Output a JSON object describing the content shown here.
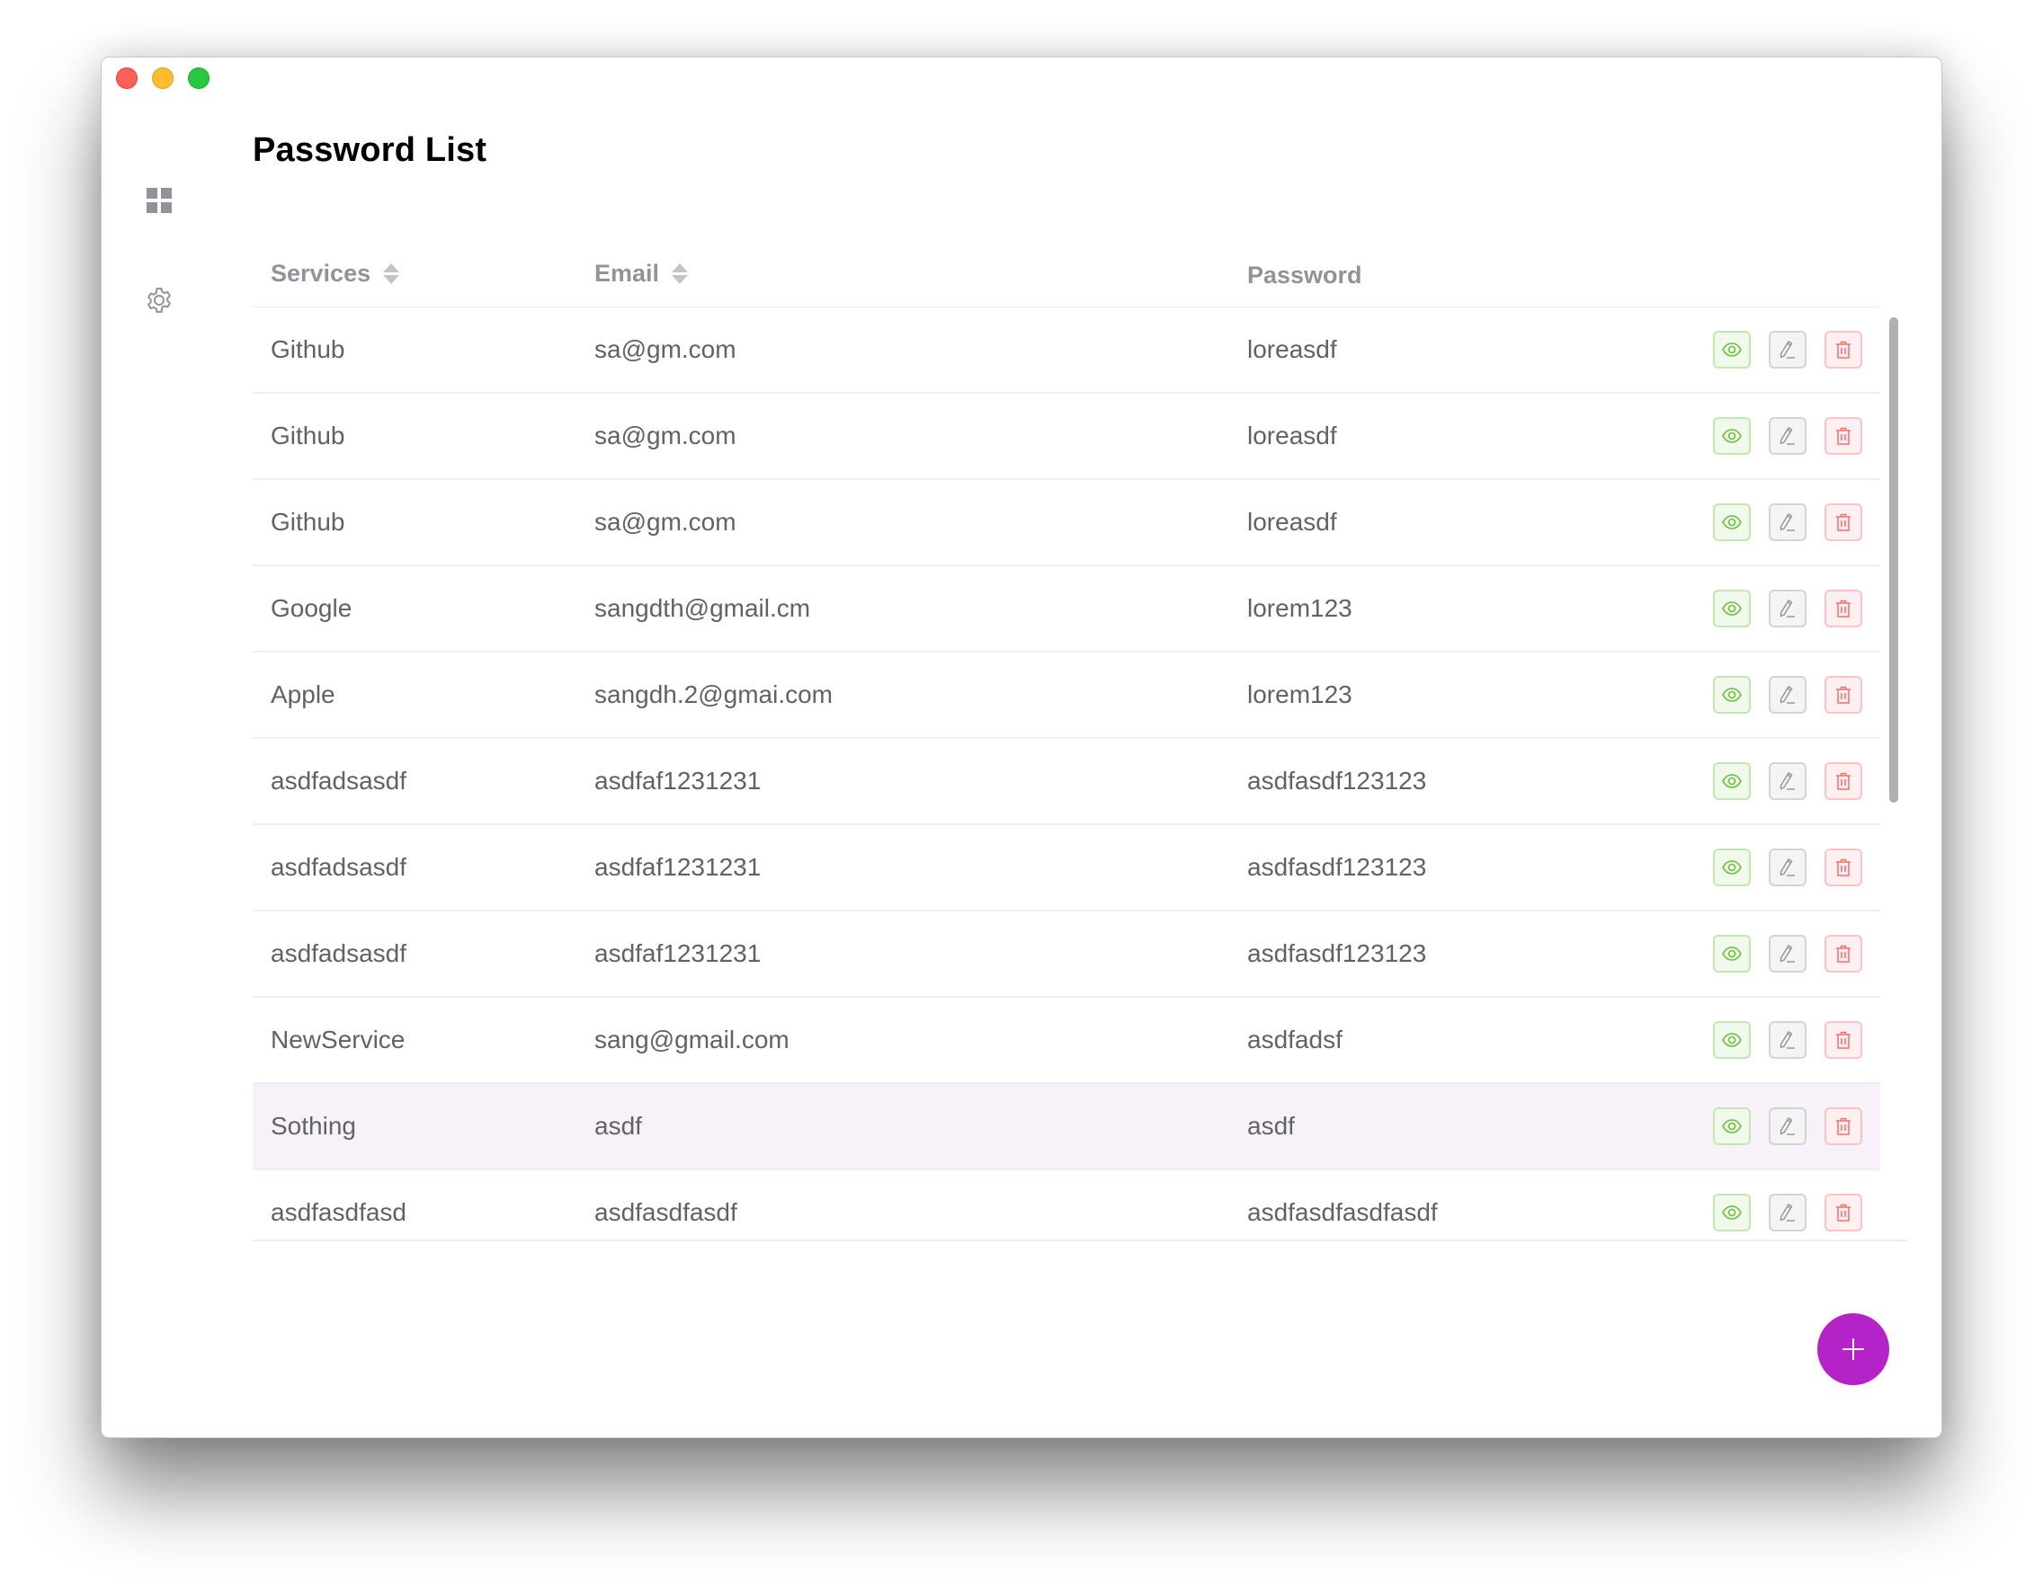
{
  "window": {
    "controls": {
      "close": "close-window",
      "minimize": "minimize-window",
      "maximize": "maximize-window"
    }
  },
  "sidebar": {
    "items": [
      {
        "icon": "grid-icon",
        "name": "dashboard"
      },
      {
        "icon": "gear-icon",
        "name": "settings"
      }
    ]
  },
  "page": {
    "title": "Password List"
  },
  "table": {
    "columns": [
      {
        "label": "Services",
        "sortable": true
      },
      {
        "label": "Email",
        "sortable": true
      },
      {
        "label": "Password",
        "sortable": false
      }
    ],
    "actions": {
      "view_icon": "eye-icon",
      "edit_icon": "edit-icon",
      "delete_icon": "trash-icon"
    },
    "rows": [
      {
        "service": "Github",
        "email": "sa@gm.com",
        "password": "loreasdf",
        "highlighted": false
      },
      {
        "service": "Github",
        "email": "sa@gm.com",
        "password": "loreasdf",
        "highlighted": false
      },
      {
        "service": "Github",
        "email": "sa@gm.com",
        "password": "loreasdf",
        "highlighted": false
      },
      {
        "service": "Google",
        "email": "sangdth@gmail.cm",
        "password": "lorem123",
        "highlighted": false
      },
      {
        "service": "Apple",
        "email": "sangdh.2@gmai.com",
        "password": "lorem123",
        "highlighted": false
      },
      {
        "service": "asdfadsasdf",
        "email": "asdfaf1231231",
        "password": "asdfasdf123123",
        "highlighted": false
      },
      {
        "service": "asdfadsasdf",
        "email": "asdfaf1231231",
        "password": "asdfasdf123123",
        "highlighted": false
      },
      {
        "service": "asdfadsasdf",
        "email": "asdfaf1231231",
        "password": "asdfasdf123123",
        "highlighted": false
      },
      {
        "service": "NewService",
        "email": "sang@gmail.com",
        "password": "asdfadsf",
        "highlighted": false
      },
      {
        "service": "Sothing",
        "email": "asdf",
        "password": "asdf",
        "highlighted": true
      },
      {
        "service": "asdfasdfasd",
        "email": "asdfasdfasdf",
        "password": "asdfasdfasdfasdf",
        "highlighted": false
      }
    ]
  },
  "fab": {
    "icon": "plus-icon",
    "label": "+"
  },
  "colors": {
    "accent": "#b523c8",
    "row_highlight": "#f8f1fa",
    "view": "#67c23a",
    "edit": "#909399",
    "delete": "#f56c6c"
  }
}
